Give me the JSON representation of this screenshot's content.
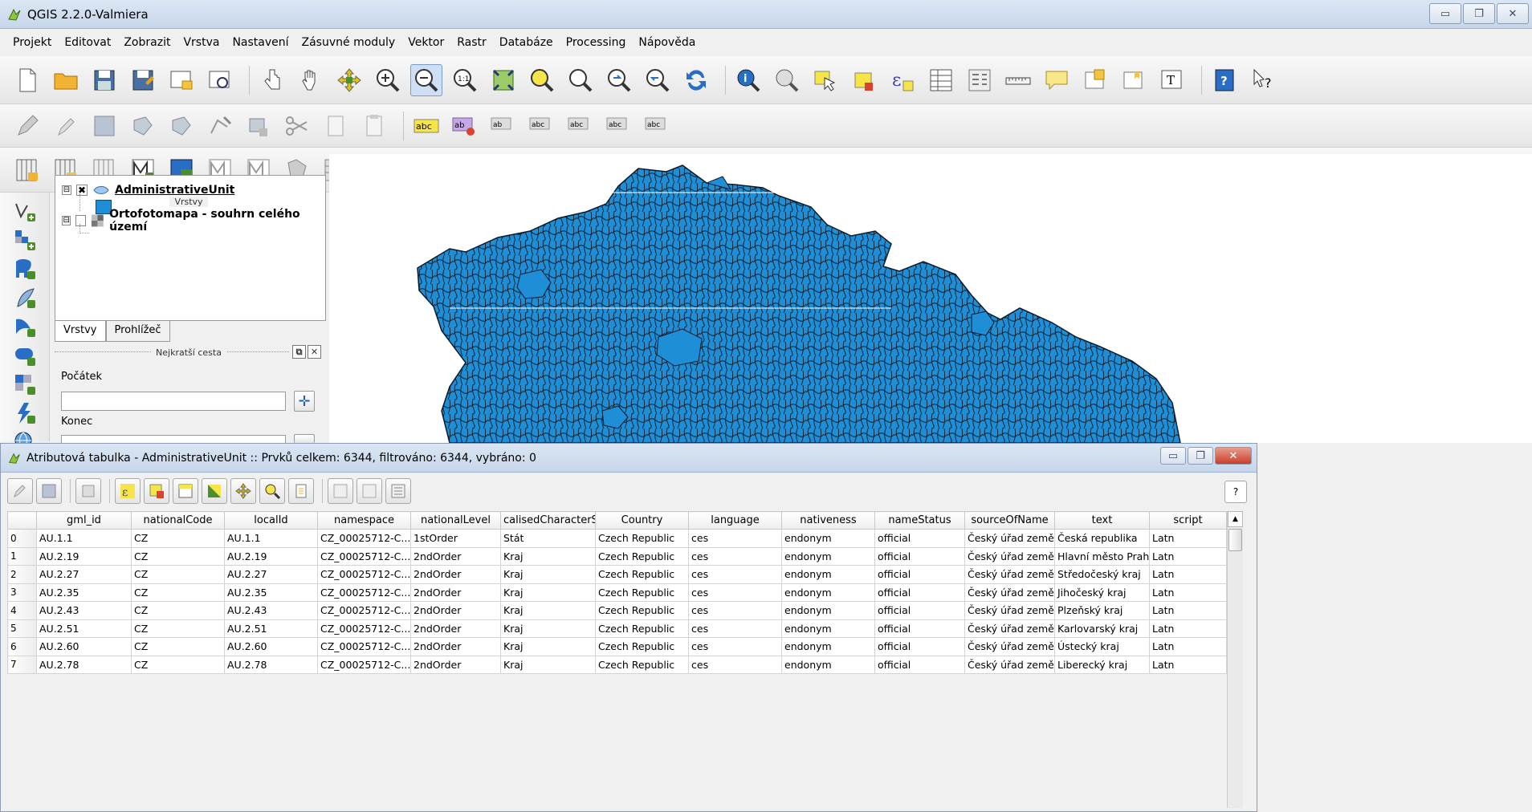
{
  "window": {
    "title": "QGIS 2.2.0-Valmiera",
    "controls": [
      "▭",
      "❐",
      "✕"
    ]
  },
  "menu": [
    "Projekt",
    "Editovat",
    "Zobrazit",
    "Vrstva",
    "Nastavení",
    "Zásuvné moduly",
    "Vektor",
    "Rastr",
    "Databáze",
    "Processing",
    "Nápověda"
  ],
  "layers_panel": {
    "title": "Vrstvy",
    "layers": [
      {
        "name": "AdministrativeUnit",
        "checked": "✖",
        "expander": "⊟"
      },
      {
        "name": "Ortofotomapa - souhrn celého území",
        "checked": "",
        "expander": "⊟"
      }
    ],
    "tabs": [
      "Vrstvy",
      "Prohlížeč"
    ]
  },
  "shortest_path_panel": {
    "title": "Nejkratší cesta",
    "start_label": "Počátek",
    "end_label": "Konec"
  },
  "colors": {
    "fill": "#1e8fd6",
    "stroke": "#0a1a2a"
  },
  "attribute_table": {
    "title": "Atributová tabulka - AdministrativeUnit :: Prvků celkem: 6344, filtrováno: 6344, vybráno: 0",
    "help": "?",
    "columns": [
      "",
      "gml_id",
      "nationalCode",
      "localId",
      "namespace",
      "nationalLevel",
      "calisedCharacterStri",
      "Country",
      "language",
      "nativeness",
      "nameStatus",
      "sourceOfName",
      "text",
      "script"
    ],
    "rows": [
      [
        "0",
        "AU.1.1",
        "CZ",
        "AU.1.1",
        "CZ_00025712-C...",
        "1stOrder",
        "Stát",
        "Czech Republic",
        "ces",
        "endonym",
        "official",
        "Český úřad země...",
        "Česká republika",
        "Latn"
      ],
      [
        "1",
        "AU.2.19",
        "CZ",
        "AU.2.19",
        "CZ_00025712-C...",
        "2ndOrder",
        "Kraj",
        "Czech Republic",
        "ces",
        "endonym",
        "official",
        "Český úřad země...",
        "Hlavní město Praha",
        "Latn"
      ],
      [
        "2",
        "AU.2.27",
        "CZ",
        "AU.2.27",
        "CZ_00025712-C...",
        "2ndOrder",
        "Kraj",
        "Czech Republic",
        "ces",
        "endonym",
        "official",
        "Český úřad země...",
        "Středočeský kraj",
        "Latn"
      ],
      [
        "3",
        "AU.2.35",
        "CZ",
        "AU.2.35",
        "CZ_00025712-C...",
        "2ndOrder",
        "Kraj",
        "Czech Republic",
        "ces",
        "endonym",
        "official",
        "Český úřad země...",
        "Jihočeský kraj",
        "Latn"
      ],
      [
        "4",
        "AU.2.43",
        "CZ",
        "AU.2.43",
        "CZ_00025712-C...",
        "2ndOrder",
        "Kraj",
        "Czech Republic",
        "ces",
        "endonym",
        "official",
        "Český úřad země...",
        "Plzeňský kraj",
        "Latn"
      ],
      [
        "5",
        "AU.2.51",
        "CZ",
        "AU.2.51",
        "CZ_00025712-C...",
        "2ndOrder",
        "Kraj",
        "Czech Republic",
        "ces",
        "endonym",
        "official",
        "Český úřad země...",
        "Karlovarský kraj",
        "Latn"
      ],
      [
        "6",
        "AU.2.60",
        "CZ",
        "AU.2.60",
        "CZ_00025712-C...",
        "2ndOrder",
        "Kraj",
        "Czech Republic",
        "ces",
        "endonym",
        "official",
        "Český úřad země...",
        "Ústecký kraj",
        "Latn"
      ],
      [
        "7",
        "AU.2.78",
        "CZ",
        "AU.2.78",
        "CZ_00025712-C...",
        "2ndOrder",
        "Kraj",
        "Czech Republic",
        "ces",
        "endonym",
        "official",
        "Český úřad země...",
        "Liberecký kraj",
        "Latn"
      ]
    ]
  }
}
